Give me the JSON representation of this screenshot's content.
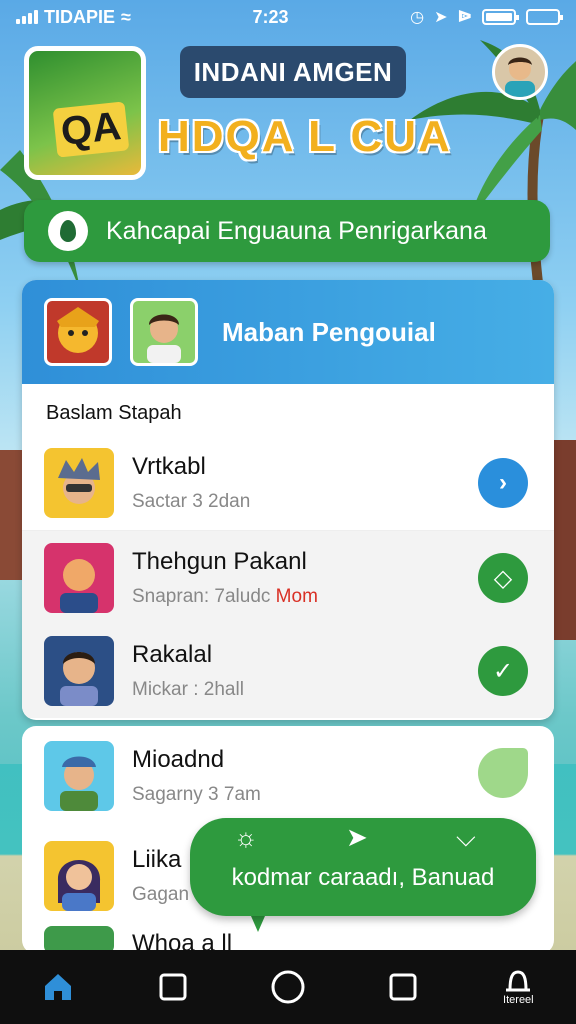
{
  "status_bar": {
    "carrier": "TIDAPIE",
    "time": "7:23"
  },
  "header": {
    "logo_text": "QA",
    "title_badge": "INDANI AMGEN",
    "subtitle": "HDQA L CUA"
  },
  "banner": {
    "text": "Kahcapai Enguauna Penrigarkana"
  },
  "card": {
    "title": "Maban Pengouial",
    "section_label": "Baslam Stapah",
    "items": [
      {
        "name": "Vrtkabl",
        "sub": "Sactar 3 2dan",
        "sub_highlight": "",
        "action_icon": "chevron-right-icon",
        "action_color": "#2a8fdc"
      },
      {
        "name": "Thehgun Pakanl",
        "sub": "Snapran: 7aludc",
        "sub_highlight": "Mom",
        "action_icon": "diamond-icon",
        "action_color": "#2e9a3e"
      },
      {
        "name": "Rakalal",
        "sub": "Mickar : 2hall",
        "sub_highlight": "",
        "action_icon": "check-icon",
        "action_color": "#2e9a3e"
      }
    ]
  },
  "card2": {
    "items": [
      {
        "name": "Mioadnd",
        "sub": "Sagarny 3 7am"
      },
      {
        "name": "Liika",
        "sub": "Gagan"
      },
      {
        "name": "Whoa a ll",
        "sub": ""
      }
    ]
  },
  "bubble": {
    "text": "kodmar caraadı, Banuad"
  },
  "nav": {
    "profile_label": "Itereel"
  },
  "colors": {
    "primary_green": "#2e9a3e",
    "primary_blue": "#2f8fd8",
    "title_gold": "#f2b01e"
  }
}
